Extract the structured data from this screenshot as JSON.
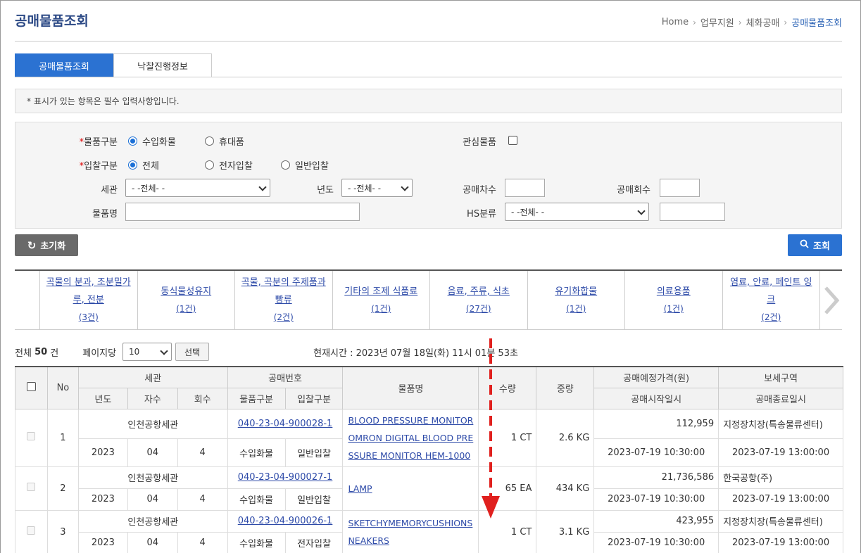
{
  "page": {
    "title": "공매물품조회"
  },
  "breadcrumb": [
    "Home",
    "업무지원",
    "체화공매",
    "공매물품조회"
  ],
  "tabs": [
    {
      "label": "공매물품조회",
      "active": true
    },
    {
      "label": "낙찰진행정보",
      "active": false
    }
  ],
  "notice": "* 표시가 있는 항목은 필수 입력사항입니다.",
  "form": {
    "item_type": {
      "label": "물품구분",
      "options": [
        "수입화물",
        "휴대품"
      ],
      "selected": "수입화물"
    },
    "interest": {
      "label": "관심물품",
      "checked": false
    },
    "bid_type": {
      "label": "입찰구분",
      "options": [
        "전체",
        "전자입찰",
        "일반입찰"
      ],
      "selected": "전체"
    },
    "customs": {
      "label": "세관",
      "value": "- -전체- -"
    },
    "year": {
      "label": "년도",
      "value": "- -전체- -"
    },
    "round_no": {
      "label": "공매차수",
      "value": ""
    },
    "round_cnt": {
      "label": "공매회수",
      "value": ""
    },
    "item_name": {
      "label": "물품명",
      "value": ""
    },
    "hs": {
      "label": "HS분류",
      "value": "- -전체- -",
      "code": ""
    }
  },
  "buttons": {
    "reset": "초기화",
    "search": "조회",
    "select": "선택"
  },
  "categories": [
    {
      "name": "곡물의 분과, 조분밀가루, 전분",
      "count": "(3건)"
    },
    {
      "name": "동식물성유지",
      "count": "(1건)"
    },
    {
      "name": "곡물, 곡분의 주제품과 빵류",
      "count": "(2건)"
    },
    {
      "name": "기타의 조제 식품료",
      "count": "(1건)"
    },
    {
      "name": "음료, 주류, 식초",
      "count": "(27건)"
    },
    {
      "name": "유기화합물",
      "count": "(1건)"
    },
    {
      "name": "의료용품",
      "count": "(1건)"
    },
    {
      "name": "염료, 안료, 페인트 잉크",
      "count": "(2건)"
    }
  ],
  "summary": {
    "total_label": "전체",
    "total": "50",
    "unit": "건",
    "per_page_label": "페이지당",
    "per_page": "10",
    "now_label": "현재시간 :",
    "now": "2023년 07월 18일(화) 11시 01분 53초"
  },
  "table": {
    "headers": {
      "no": "No",
      "customs": "세관",
      "sale_no": "공매번호",
      "item": "물품명",
      "qty": "수량",
      "weight": "중량",
      "price": "공매예정가격(원)",
      "bonded": "보세구역",
      "year": "년도",
      "round": "자수",
      "count": "회수",
      "type": "물품구분",
      "bid": "입찰구분",
      "start": "공매시작일시",
      "end": "공매종료일시"
    },
    "rows": [
      {
        "no": "1",
        "customs": "인천공항세관",
        "sale_no": "040-23-04-900028-1",
        "item": [
          "BLOOD PRESSURE MONITOR",
          "OMRON DIGITAL BLOOD PRE",
          "SSURE MONITOR HEM-1000"
        ],
        "qty": "1 CT",
        "weight": "2.6 KG",
        "price": "112,959",
        "bonded": "지정장치장(특송물류센터)",
        "year": "2023",
        "round": "04",
        "count": "4",
        "type": "수입화물",
        "bid": "일반입찰",
        "start": "2023-07-19 10:30:00",
        "end": "2023-07-19 13:00:00"
      },
      {
        "no": "2",
        "customs": "인천공항세관",
        "sale_no": "040-23-04-900027-1",
        "item": [
          "LAMP"
        ],
        "qty": "65 EA",
        "weight": "434 KG",
        "price": "21,736,586",
        "bonded": "한국공항(주)",
        "year": "2023",
        "round": "04",
        "count": "4",
        "type": "수입화물",
        "bid": "일반입찰",
        "start": "2023-07-19 10:30:00",
        "end": "2023-07-19 13:00:00"
      },
      {
        "no": "3",
        "customs": "인천공항세관",
        "sale_no": "040-23-04-900026-1",
        "item": [
          "SKETCHYMEMORYCUSHIONS",
          "NEAKERS"
        ],
        "qty": "1 CT",
        "weight": "3.1 KG",
        "price": "423,955",
        "bonded": "지정장치장(특송물류센터)",
        "year": "2023",
        "round": "04",
        "count": "4",
        "type": "수입화물",
        "bid": "전자입찰",
        "start": "2023-07-19 10:30:00",
        "end": "2023-07-19 13:00:00"
      }
    ]
  },
  "colors": {
    "primary": "#2b72d2",
    "title": "#2d4a86",
    "link": "#2d4aa8",
    "arrow": "#e0201e"
  }
}
